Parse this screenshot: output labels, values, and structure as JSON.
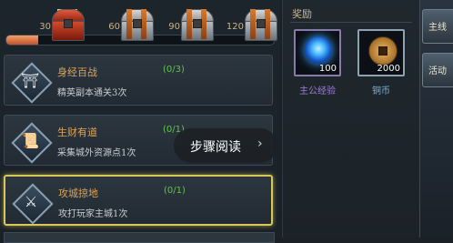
{
  "progress": {
    "fill_percent": 12,
    "milestones": [
      {
        "value": "30",
        "style": "red"
      },
      {
        "value": "60",
        "style": "silver"
      },
      {
        "value": "90",
        "style": "silver"
      },
      {
        "value": "120",
        "style": "silver"
      }
    ]
  },
  "quests": [
    {
      "title": "身经百战",
      "progress": "(0/3)",
      "desc": "精英副本通关3次",
      "icon": "pagoda-icon",
      "glyph": "⛩"
    },
    {
      "title": "生财有道",
      "progress": "(0/1)",
      "desc": "采集城外资源点1次",
      "icon": "scroll-icon",
      "glyph": "📜"
    },
    {
      "title": "攻城掠地",
      "progress": "(0/1)",
      "desc": "攻打玩家主城1次",
      "icon": "crossed-swords-icon",
      "glyph": "⚔"
    }
  ],
  "rewards": {
    "title": "奖励",
    "items": [
      {
        "name": "主公经验",
        "amount": "100",
        "icon": "exp-orb-icon",
        "name_color": "#9f7fd6"
      },
      {
        "name": "铜币",
        "amount": "2000",
        "icon": "copper-coin-icon",
        "name_color": "#7fb0d6"
      }
    ]
  },
  "side_buttons": [
    {
      "label": "主线"
    },
    {
      "label": "活动"
    }
  ],
  "overlay": {
    "label": "步骤阅读",
    "chevron": "›"
  }
}
